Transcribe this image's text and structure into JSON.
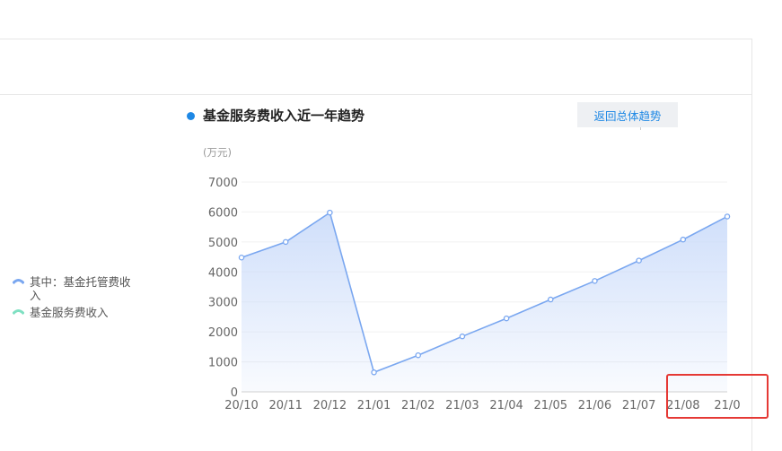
{
  "chart": {
    "title": "基金服务费收入近一年趋势",
    "unit": "(万元)",
    "back_button_label": "返回总体趋势"
  },
  "legend": {
    "items": [
      {
        "label": "其中：基金托管费收入",
        "color": "#7aa7f0"
      },
      {
        "label": "基金服务费收入",
        "color": "#7fe0c2"
      }
    ]
  },
  "chart_data": {
    "type": "area",
    "categories": [
      "20/10",
      "20/11",
      "20/12",
      "21/01",
      "21/02",
      "21/03",
      "21/04",
      "21/05",
      "21/06",
      "21/07",
      "21/08",
      "21/0"
    ],
    "series": [
      {
        "values": [
          4480,
          5000,
          5980,
          650,
          1220,
          1850,
          2450,
          3080,
          3700,
          4380,
          5080,
          5850
        ],
        "color": "#7aa7f0"
      }
    ],
    "ylabel": "(万元)",
    "ylim": [
      0,
      7000
    ],
    "yticks": [
      0,
      1000,
      2000,
      3000,
      4000,
      5000,
      6000,
      7000
    ],
    "grid": true
  }
}
